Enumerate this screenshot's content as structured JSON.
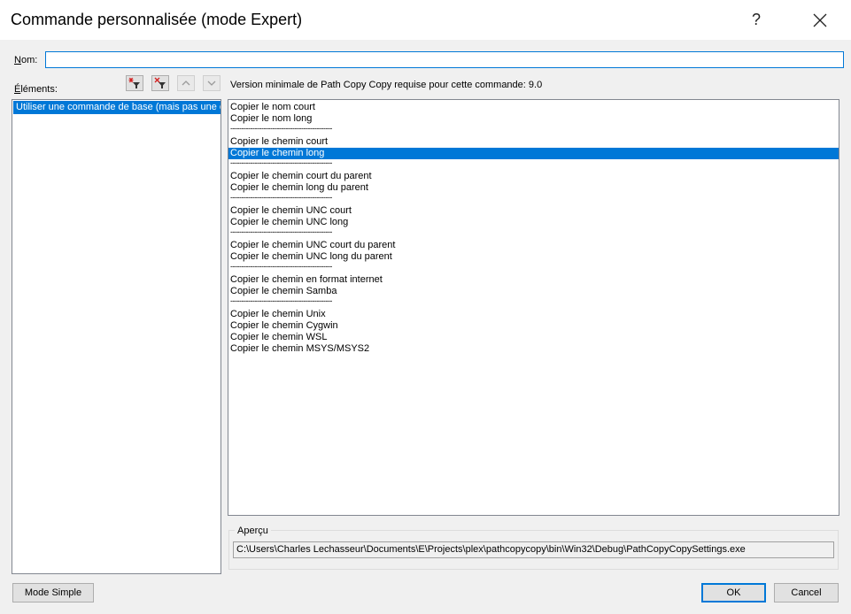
{
  "window": {
    "title": "Commande personnalisée (mode Expert)",
    "help_glyph": "?"
  },
  "name_field": {
    "label_underlined": "N",
    "label_rest": "om:",
    "value": ""
  },
  "elements": {
    "label_underlined": "É",
    "label_rest": "léments:",
    "items": [
      {
        "label": "Utiliser une commande de base (mais pas une commande personnalisée)"
      }
    ]
  },
  "toolbar": {
    "icons": [
      "add-filter-icon",
      "remove-filter-icon",
      "chevron-up-icon",
      "chevron-down-icon"
    ]
  },
  "version_note": "Version minimale de Path Copy Copy requise pour cette commande: 9.0",
  "commands": {
    "separator": "----------------------------------------------",
    "items": [
      {
        "type": "item",
        "label": "Copier le nom court"
      },
      {
        "type": "item",
        "label": "Copier le nom long"
      },
      {
        "type": "sep"
      },
      {
        "type": "item",
        "label": "Copier le chemin court"
      },
      {
        "type": "item",
        "label": "Copier le chemin long",
        "selected": true
      },
      {
        "type": "sep"
      },
      {
        "type": "item",
        "label": "Copier le chemin court du parent"
      },
      {
        "type": "item",
        "label": "Copier le chemin long du parent"
      },
      {
        "type": "sep"
      },
      {
        "type": "item",
        "label": "Copier le chemin UNC court"
      },
      {
        "type": "item",
        "label": "Copier le chemin UNC long"
      },
      {
        "type": "sep"
      },
      {
        "type": "item",
        "label": "Copier le chemin UNC court du parent"
      },
      {
        "type": "item",
        "label": "Copier le chemin UNC long du parent"
      },
      {
        "type": "sep"
      },
      {
        "type": "item",
        "label": "Copier le chemin en format internet"
      },
      {
        "type": "item",
        "label": "Copier le chemin Samba"
      },
      {
        "type": "sep"
      },
      {
        "type": "item",
        "label": "Copier le chemin Unix"
      },
      {
        "type": "item",
        "label": "Copier le chemin Cygwin"
      },
      {
        "type": "item",
        "label": "Copier le chemin WSL"
      },
      {
        "type": "item",
        "label": "Copier le chemin MSYS/MSYS2"
      }
    ]
  },
  "preview": {
    "label": "Aperçu",
    "value": "C:\\Users\\Charles Lechasseur\\Documents\\E\\Projects\\plex\\pathcopycopy\\bin\\Win32\\Debug\\PathCopyCopySettings.exe"
  },
  "buttons": {
    "simple_mode": "Mode Simple",
    "ok": "OK",
    "cancel": "Cancel"
  },
  "colors": {
    "accent": "#0078d7",
    "filter_red": "#d42020"
  }
}
